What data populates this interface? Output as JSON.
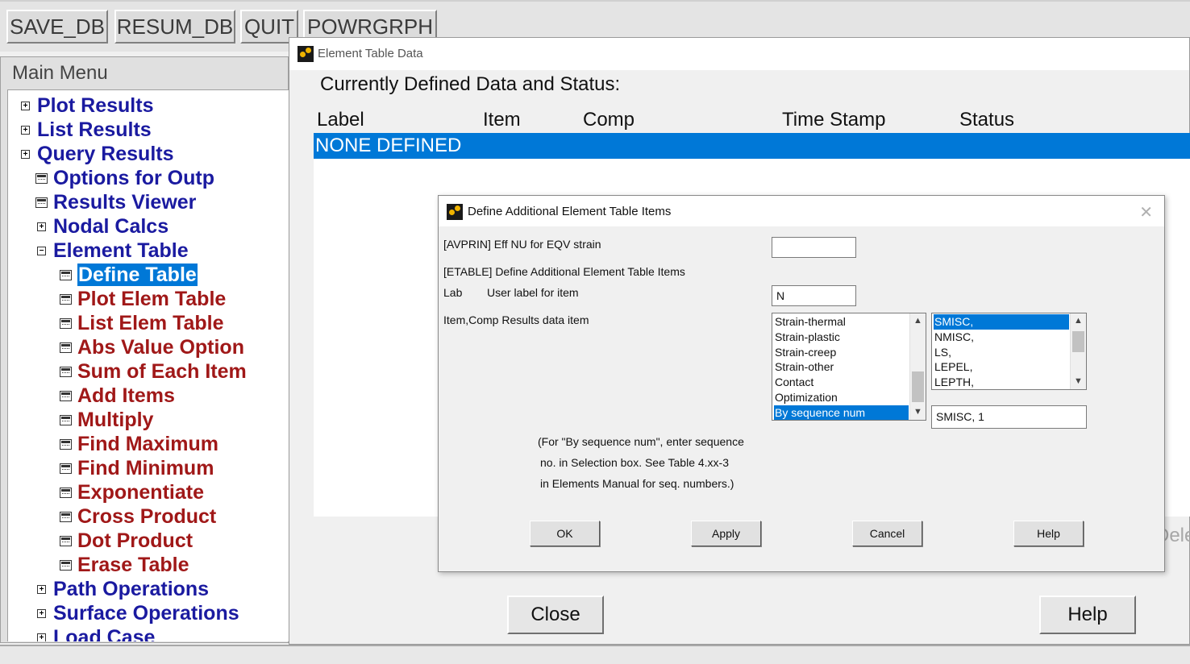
{
  "toolbar": {
    "buttons": [
      "SAVE_DB",
      "RESUM_DB",
      "QUIT",
      "POWRGRPH"
    ]
  },
  "main_menu": {
    "title": "Main Menu",
    "items": [
      {
        "label": "Plot Results",
        "expander": "+"
      },
      {
        "label": "List Results",
        "expander": "+"
      },
      {
        "label": "Query Results",
        "expander": "+"
      },
      {
        "label": "Options for Outp"
      },
      {
        "label": "Results Viewer"
      },
      {
        "label": "Nodal Calcs",
        "expander": "+"
      },
      {
        "label": "Element Table",
        "expander": "−"
      },
      {
        "label": "Define Table",
        "selected": true
      },
      {
        "label": "Plot Elem Table"
      },
      {
        "label": "List Elem Table"
      },
      {
        "label": "Abs Value Option"
      },
      {
        "label": "Sum of Each Item"
      },
      {
        "label": "Add Items"
      },
      {
        "label": "Multiply"
      },
      {
        "label": "Find Maximum"
      },
      {
        "label": "Find Minimum"
      },
      {
        "label": "Exponentiate"
      },
      {
        "label": "Cross Product"
      },
      {
        "label": "Dot Product"
      },
      {
        "label": "Erase Table"
      },
      {
        "label": "Path Operations",
        "expander": "+"
      },
      {
        "label": "Surface Operations",
        "expander": "+"
      },
      {
        "label": "Load Case",
        "expander": "+"
      }
    ]
  },
  "element_table_window": {
    "title": "Element Table Data",
    "heading": "Currently Defined Data and Status:",
    "columns": [
      "Label",
      "Item",
      "Comp",
      "Time Stamp",
      "Status"
    ],
    "rows": [
      "NONE DEFINED"
    ],
    "delete_label": "Delete",
    "close_label": "Close",
    "help_label": "Help"
  },
  "dialog": {
    "title": "Define Additional Element Table Items",
    "avprin_label": "[AVPRIN]  Eff NU for EQV strain",
    "avprin_value": "",
    "etable_label": "[ETABLE]  Define Additional Element Table Items",
    "lab_key": "Lab",
    "lab_desc": "User label for item",
    "lab_value": "N",
    "item_comp_label": "Item,Comp  Results data item",
    "item_list": [
      "Strain-thermal",
      "Strain-plastic",
      "Strain-creep",
      "Strain-other",
      "Contact",
      "Optimization",
      "By sequence num"
    ],
    "item_selected": "By sequence num",
    "comp_list": [
      "SMISC,",
      "NMISC,",
      "LS,",
      "LEPEL,",
      "LEPTH,"
    ],
    "comp_selected": "SMISC,",
    "selection_value": "SMISC, 1",
    "note_lines": [
      "(For \"By sequence num\", enter sequence",
      "no. in Selection box.  See Table 4.xx-3",
      "in Elements Manual for seq. numbers.)"
    ],
    "buttons": {
      "ok": "OK",
      "apply": "Apply",
      "cancel": "Cancel",
      "help": "Help"
    }
  },
  "colors": {
    "selection": "#0078d7",
    "menu_blue": "#1a1aa0",
    "menu_red": "#a01818"
  }
}
